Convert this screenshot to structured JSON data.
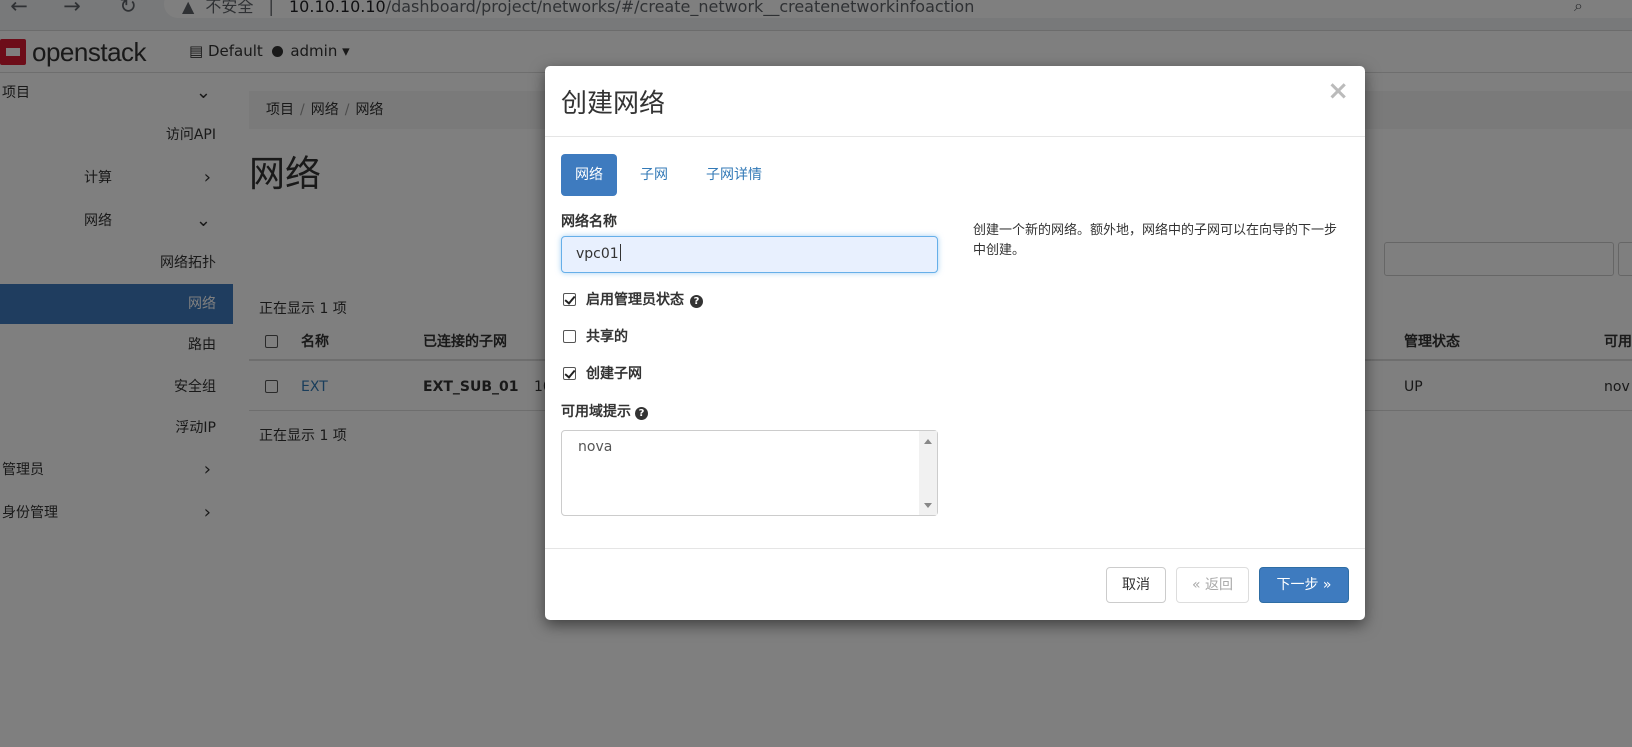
{
  "browser": {
    "back_icon": "←",
    "forward_icon": "→",
    "reload_icon": "↻",
    "warning_icon": "▲",
    "security_label": "不安全",
    "separator": "|",
    "url_host": "10.10.10.10",
    "url_path": "/dashboard/project/networks/#/create_network__createnetworkinfoaction"
  },
  "topnav": {
    "logo_text": "openstack",
    "domain": "Default",
    "project": "admin",
    "caret": "▾"
  },
  "sidebar": {
    "items": [
      {
        "label": "项目",
        "chev": "⌄"
      },
      {
        "label": "访问API"
      },
      {
        "label": "计算",
        "chev": "›"
      },
      {
        "label": "网络",
        "chev": "⌄"
      },
      {
        "label": "网络拓扑"
      },
      {
        "label": "网络"
      },
      {
        "label": "路由"
      },
      {
        "label": "安全组"
      },
      {
        "label": "浮动IP"
      },
      {
        "label": "管理员",
        "chev": "›"
      },
      {
        "label": "身份管理",
        "chev": "›"
      }
    ]
  },
  "content": {
    "breadcrumb": [
      "项目",
      "网络",
      "网络"
    ],
    "breadcrumb_sep": "/",
    "title": "网络",
    "showing_top": "正在显示 1 项",
    "showing_bottom": "正在显示 1 项",
    "table": {
      "headers": [
        "名称",
        "已连接的子网",
        "管理状态",
        "可用"
      ],
      "row": {
        "name": "EXT",
        "subnet": "EXT_SUB_01",
        "subnet_more": "10.",
        "admin_state": "UP",
        "az": "nov"
      }
    }
  },
  "modal": {
    "title": "创建网络",
    "close": "×",
    "tabs": [
      "网络",
      "子网",
      "子网详情"
    ],
    "name_label": "网络名称",
    "name_value": "vpc01",
    "admin_state_label": "启用管理员状态",
    "shared_label": "共享的",
    "create_subnet_label": "创建子网",
    "az_label": "可用域提示",
    "az_option": "nova",
    "help_icon": "?",
    "help_text": "创建一个新的网络。额外地，网络中的子网可以在向导的下一步中创建。",
    "cancel": "取消",
    "back": "« 返回",
    "next": "下一步 »"
  },
  "colors": {
    "accent": "#3e7bbf",
    "overlay": "rgba(0,0,0,0.5)"
  }
}
